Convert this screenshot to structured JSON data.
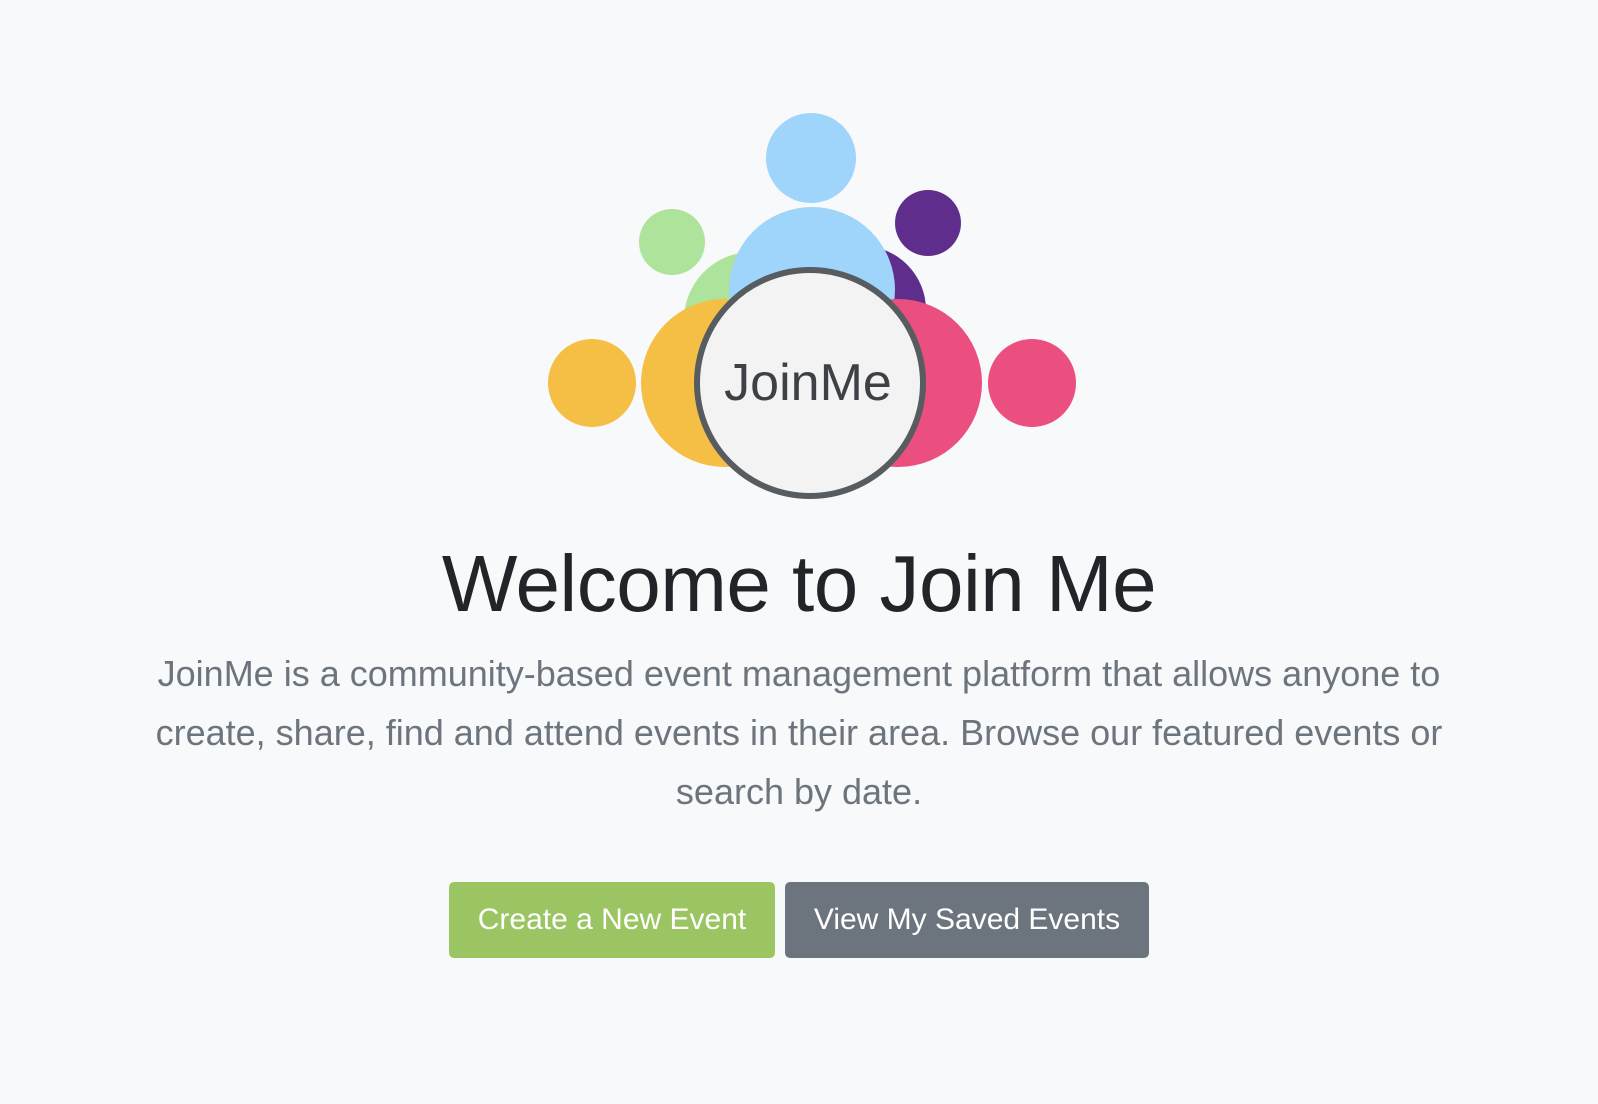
{
  "logo": {
    "text": "JoinMe",
    "colors": {
      "light_blue": "#9fd4fb",
      "light_green": "#aee39b",
      "purple": "#5f2e8d",
      "yellow": "#f4bf44",
      "pink": "#ea4f7f",
      "ring": "#575c61",
      "center": "#f3f3f3"
    }
  },
  "hero": {
    "title": "Welcome to Join Me",
    "description": "JoinMe is a community-based event management platform that allows anyone to create, share, find and attend events in their area. Browse our featured events or search by date."
  },
  "actions": {
    "create_label": "Create a New Event",
    "saved_label": "View My Saved Events"
  },
  "theme": {
    "background": "#f8f9fa",
    "primary_green": "#9bc462",
    "secondary_gray": "#6c757d"
  }
}
